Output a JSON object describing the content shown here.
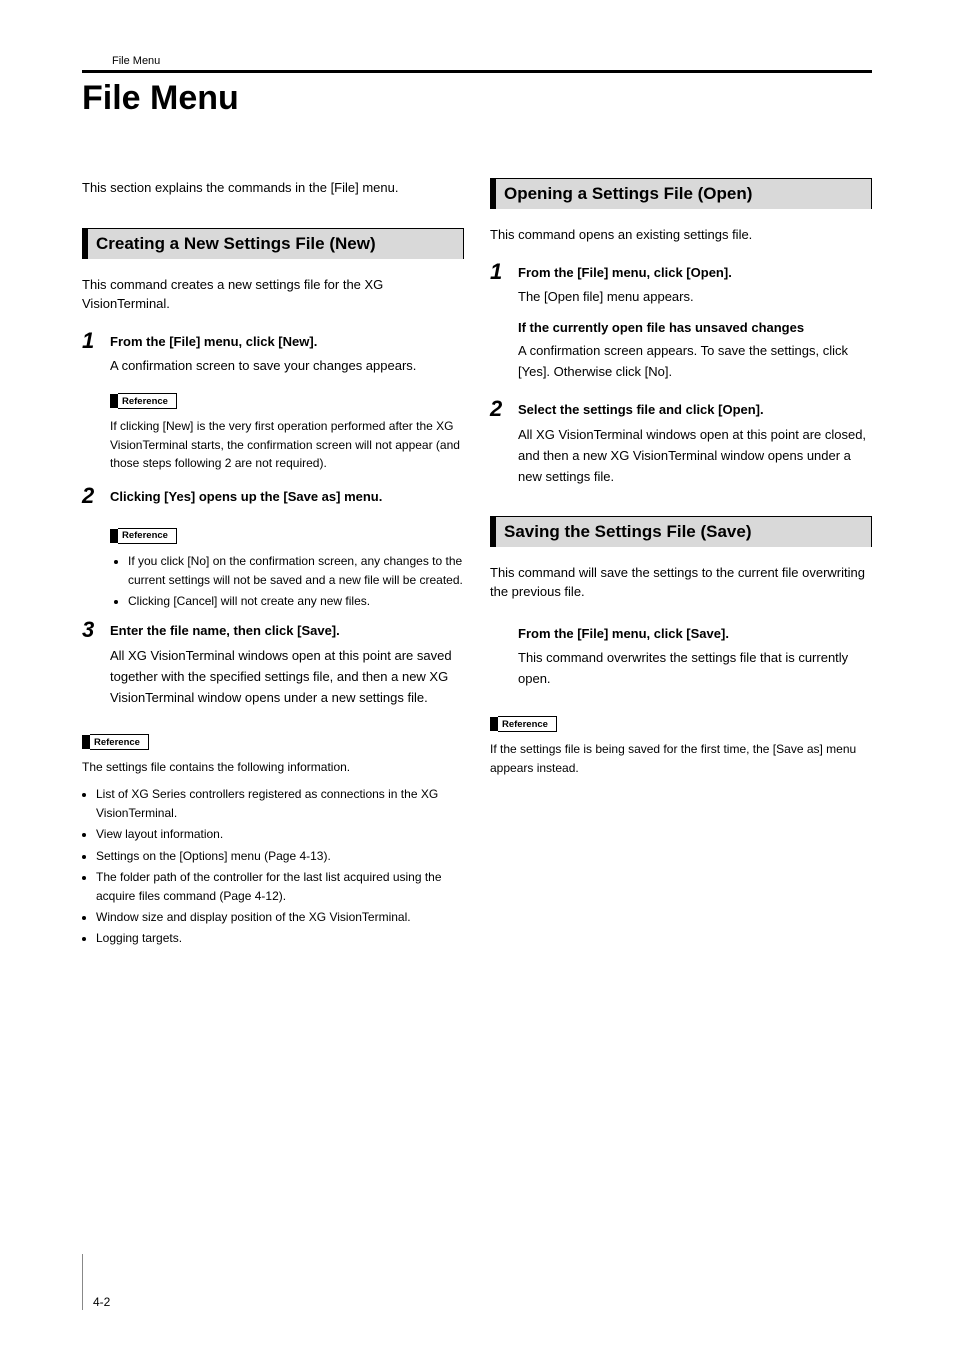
{
  "runningHead": "File Menu",
  "pageTitle": "File Menu",
  "referenceLabel": "Reference",
  "pageNumber": "4-2",
  "left": {
    "intro": "This section explains the commands in the [File] menu.",
    "sectionA": {
      "title": "Creating a New Settings File (New)",
      "desc": "This command creates a new settings file for the XG VisionTerminal.",
      "step1": {
        "num": "1",
        "title": "From the [File] menu, click [New].",
        "body": "A confirmation screen to save your changes appears.",
        "ref": "If clicking [New] is the very first operation performed after the XG VisionTerminal starts, the confirmation screen will not appear (and those steps following 2 are not required)."
      },
      "step2": {
        "num": "2",
        "title": "Clicking [Yes] opens up the [Save as] menu.",
        "bullets": [
          "If you click [No] on the confirmation screen, any changes to the current settings will not be saved and a new file will be created.",
          "Clicking [Cancel] will not create any new files."
        ]
      },
      "step3": {
        "num": "3",
        "title": "Enter the file name, then click [Save].",
        "body": "All XG VisionTerminal windows open at this point are saved together with the specified settings file, and then a new XG VisionTerminal window opens under a new settings file."
      },
      "finalRefIntro": "The settings file contains the following information.",
      "finalBullets": [
        "List of XG Series controllers registered as connections in the XG VisionTerminal.",
        "View layout information.",
        "Settings on the [Options] menu (Page 4-13).",
        "The folder path of the controller for the last list acquired using the acquire files command (Page 4-12).",
        "Window size and display position of the XG VisionTerminal.",
        "Logging targets."
      ]
    }
  },
  "right": {
    "sectionB": {
      "title": "Opening a Settings File (Open)",
      "desc": "This command opens an existing settings file.",
      "step1": {
        "num": "1",
        "title": "From the [File] menu, click [Open].",
        "body": "The [Open file] menu appears.",
        "subTitle": "If the currently open file has unsaved changes",
        "subBody": "A confirmation screen appears. To save the settings, click [Yes]. Otherwise click [No]."
      },
      "step2": {
        "num": "2",
        "title": "Select the settings file and click [Open].",
        "body": "All XG VisionTerminal windows open at this point are closed, and then a new XG VisionTerminal window opens under a new settings file."
      }
    },
    "sectionC": {
      "title": "Saving the Settings File (Save)",
      "desc": "This command will save the settings to the current file overwriting the previous file.",
      "step": {
        "title": "From the [File] menu, click [Save].",
        "body": "This command overwrites the settings file that is currently open."
      },
      "ref": "If the settings file is being saved for the first time, the [Save as] menu appears instead."
    }
  }
}
